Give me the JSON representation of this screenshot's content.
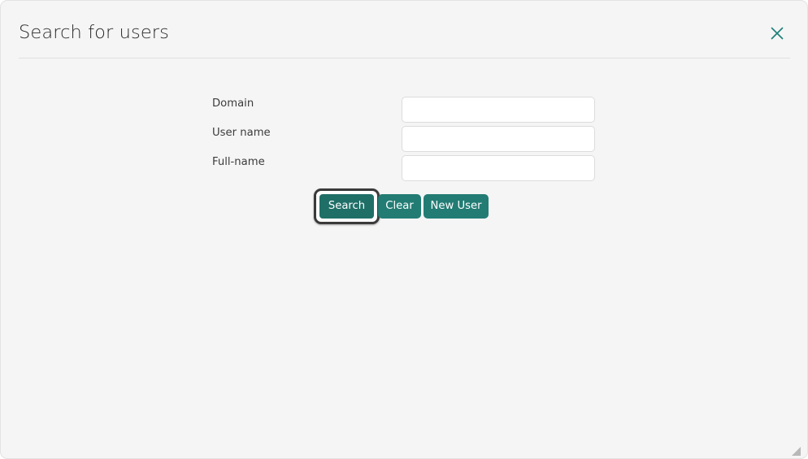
{
  "window": {
    "title": "Search for users",
    "background": "#f5f5f5",
    "accent": "#227c74"
  },
  "header": {
    "title": "Search for users",
    "close_icon": "close-icon"
  },
  "form": {
    "fields": [
      {
        "label": "Domain",
        "value": "",
        "placeholder": ""
      },
      {
        "label": "User name",
        "value": "",
        "placeholder": ""
      },
      {
        "label": "Full-name",
        "value": "",
        "placeholder": ""
      }
    ]
  },
  "buttons": {
    "search": "Search",
    "clear": "Clear",
    "new_user": "New User"
  },
  "resize_grip": "resize-grip-icon"
}
